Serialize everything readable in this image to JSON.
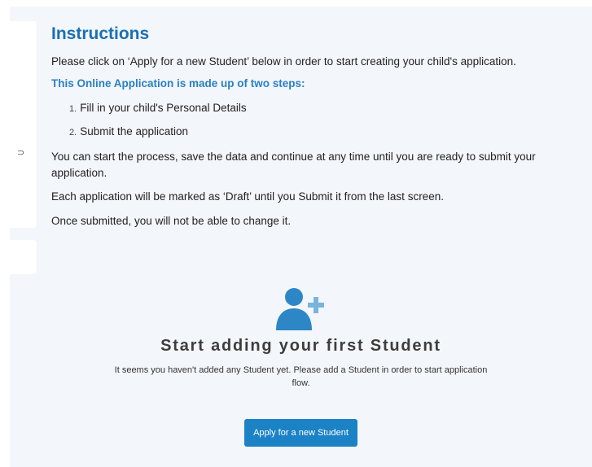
{
  "instructions": {
    "title": "Instructions",
    "intro": "Please click on ‘Apply for a new Student’ below in order to start creating your child's application.",
    "steps_heading": "This Online Application is made up of two steps:",
    "steps": [
      {
        "num": "1.",
        "label": "Fill in your child's Personal Details"
      },
      {
        "num": "2.",
        "label": "Submit the application"
      }
    ],
    "para_process": "You can start the process, save the data and continue at any time until you are ready to submit your application.",
    "para_draft": "Each application will be marked as ‘Draft’ until you Submit it from the last screen.",
    "para_submitted": "Once submitted, you will not be able to change it."
  },
  "sidebar": {
    "glyph": "⊃"
  },
  "empty_state": {
    "icon": "add-user-icon",
    "title": "Start adding your first Student",
    "text": "It seems you haven't added any Student yet. Please add a Student in order to start application flow.",
    "button_label": "Apply for a new Student"
  },
  "colors": {
    "accent": "#1a6fb3",
    "button": "#1b82c5",
    "icon": "#2d86c6",
    "panel_bg": "#f3f6fa"
  }
}
